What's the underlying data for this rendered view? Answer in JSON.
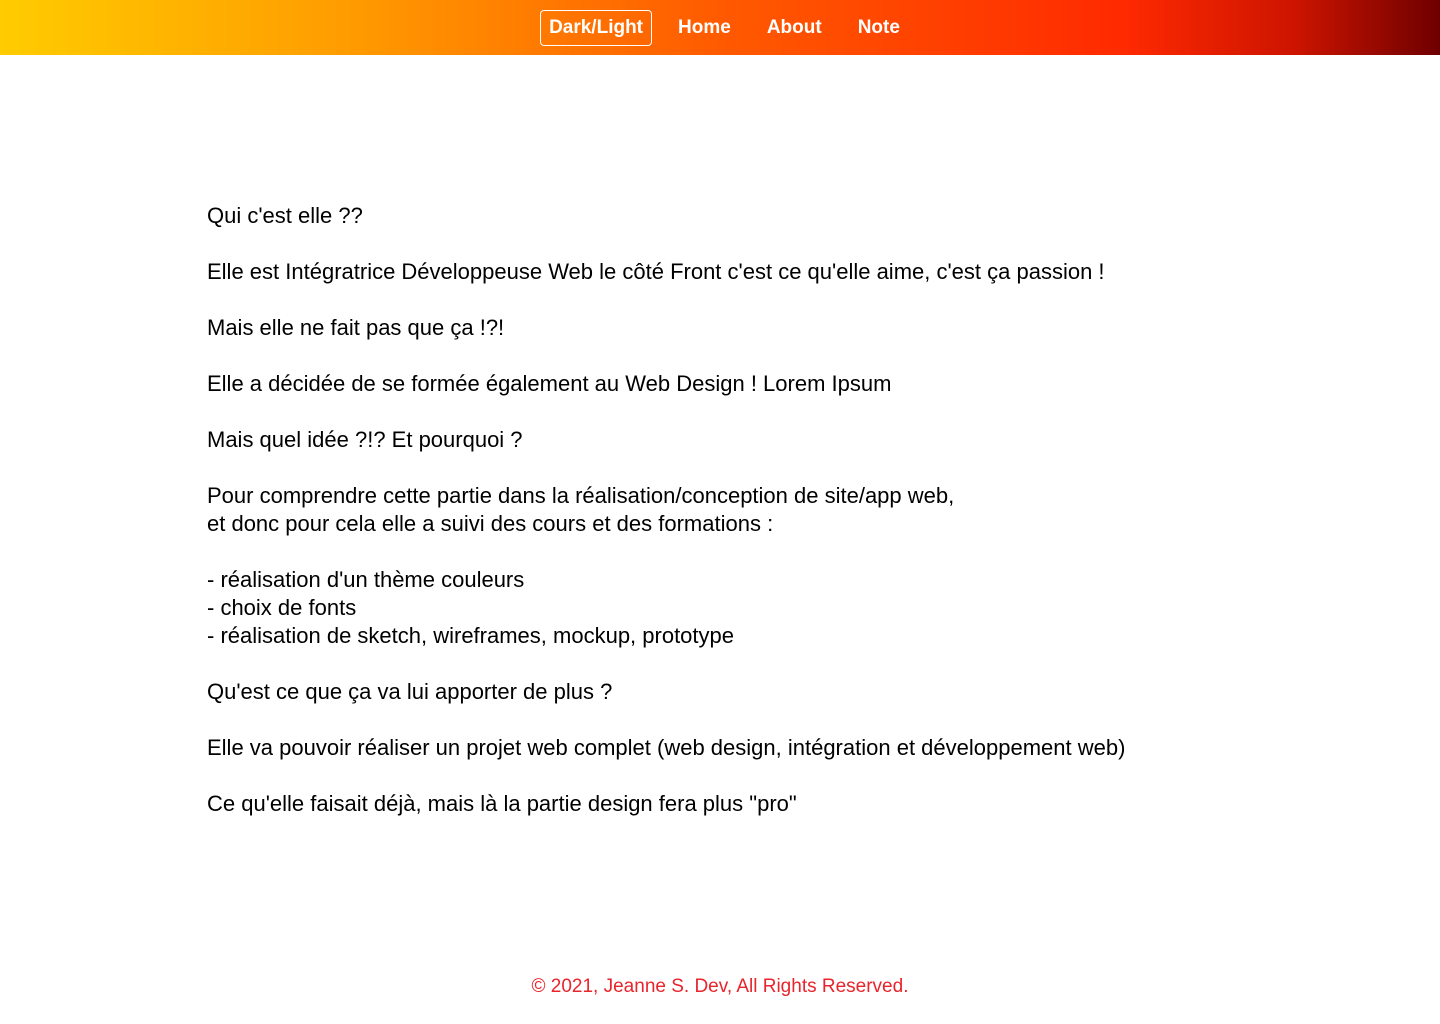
{
  "header": {
    "toggle_label": "Dark/Light",
    "nav": [
      {
        "label": "Home"
      },
      {
        "label": "About"
      },
      {
        "label": "Note"
      }
    ]
  },
  "content": {
    "p1": "Qui c'est elle ??",
    "p2": "Elle est Intégratrice Développeuse Web le côté Front c'est ce qu'elle aime, c'est ça passion !",
    "p3": "Mais elle ne fait pas que ça !?!",
    "p4": "Elle a décidée de se formée également au Web Design ! Lorem Ipsum",
    "p5": "Mais quel idée ?!? Et pourquoi ?",
    "p6_line1": "Pour comprendre cette partie dans la réalisation/conception de site/app web,",
    "p6_line2": "et donc pour cela elle a suivi des cours et des formations :",
    "list": [
      "- réalisation d'un thème couleurs",
      "- choix de fonts",
      "- réalisation de sketch, wireframes, mockup, prototype"
    ],
    "p7": "Qu'est ce que ça va lui apporter de plus ?",
    "p8": "Elle va pouvoir réaliser un projet web complet (web design, intégration et développement web)",
    "p9": "Ce qu'elle faisait déjà, mais là la partie design fera plus \"pro\""
  },
  "footer": {
    "text": "© 2021, Jeanne S. Dev, All Rights Reserved."
  },
  "colors": {
    "header_gradient_start": "#ffcc00",
    "header_gradient_mid": "#ff2a00",
    "header_gradient_end": "#6e0000",
    "footer_text": "#e8242c"
  }
}
